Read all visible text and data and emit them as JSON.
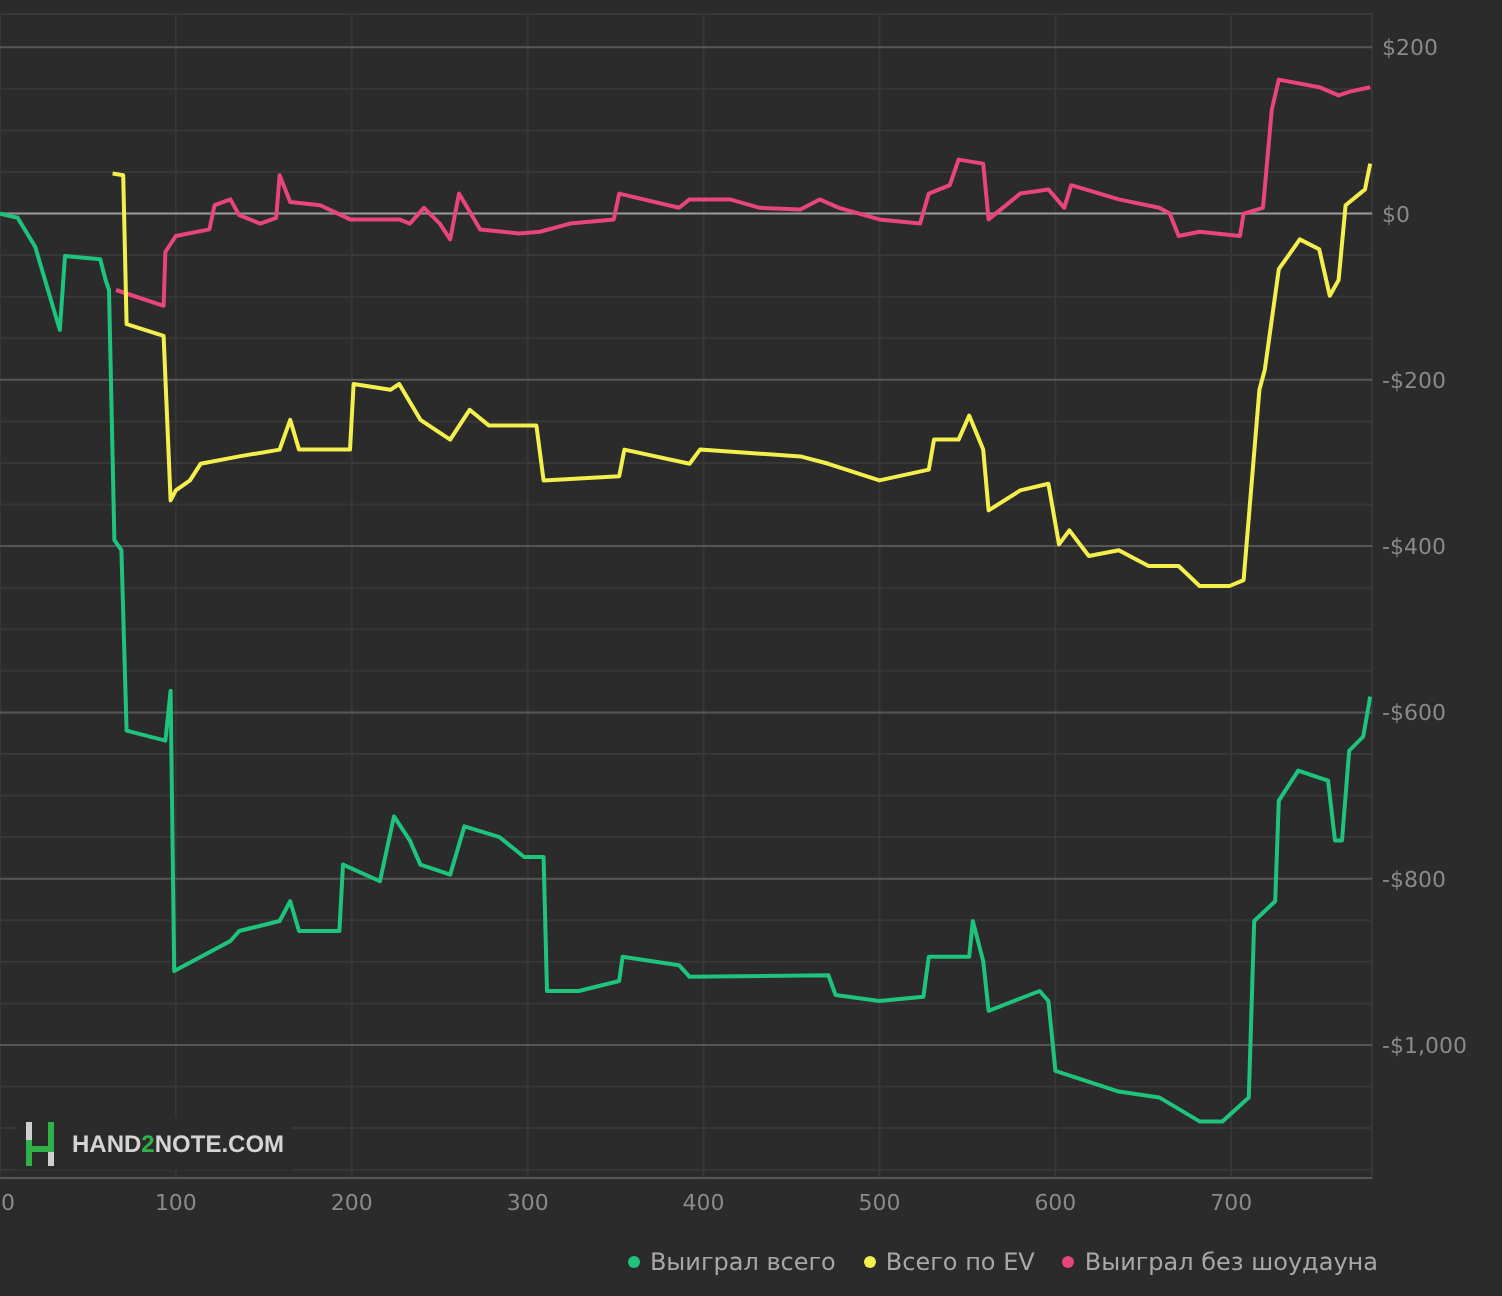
{
  "chart": {
    "chart_data": {
      "type": "line",
      "grid": true,
      "xlim": [
        0,
        780
      ],
      "ylim": [
        -1160,
        240
      ],
      "xticks": [
        0,
        100,
        200,
        300,
        400,
        500,
        600,
        700
      ],
      "yticks": [
        {
          "value": 200,
          "label": "$200"
        },
        {
          "value": 0,
          "label": "$0"
        },
        {
          "value": -200,
          "label": "-$200"
        },
        {
          "value": -400,
          "label": "-$400"
        },
        {
          "value": -600,
          "label": "-$600"
        },
        {
          "value": -800,
          "label": "-$800"
        },
        {
          "value": -1000,
          "label": "-$1,000"
        }
      ],
      "series": [
        {
          "name": "Выиграл всего",
          "color": "#1ec47c",
          "x": [
            0,
            10,
            20,
            34,
            37,
            57,
            60,
            62,
            65,
            69,
            72,
            94,
            97,
            99,
            131,
            136,
            159,
            165,
            170,
            193,
            195,
            216,
            224,
            233,
            239,
            256,
            264,
            284,
            298,
            309,
            311,
            329,
            352,
            354,
            386,
            392,
            471,
            475,
            500,
            525,
            528,
            551,
            553,
            559,
            562,
            591,
            596,
            600,
            636,
            659,
            682,
            695,
            710,
            713,
            725,
            727,
            738,
            755,
            759,
            763,
            767,
            775,
            779
          ],
          "values": [
            0,
            -5,
            -40,
            -140,
            -51,
            -55,
            -80,
            -92,
            -393,
            -405,
            -622,
            -634,
            -574,
            -911,
            -875,
            -863,
            -851,
            -827,
            -863,
            -863,
            -783,
            -803,
            -725,
            -754,
            -783,
            -795,
            -737,
            -750,
            -774,
            -774,
            -935,
            -935,
            -923,
            -894,
            -904,
            -918,
            -916,
            -940,
            -947,
            -942,
            -894,
            -894,
            -851,
            -899,
            -959,
            -935,
            -947,
            -1031,
            -1056,
            -1063,
            -1092,
            -1092,
            -1063,
            -851,
            -827,
            -706,
            -670,
            -682,
            -754,
            -754,
            -646,
            -629,
            -581
          ]
        },
        {
          "name": "Всего по EV",
          "color": "#f4ef4c",
          "x": [
            64,
            70,
            72,
            93,
            97,
            100,
            108,
            114,
            136,
            159,
            165,
            170,
            199,
            201,
            222,
            227,
            239,
            256,
            267,
            278,
            305,
            309,
            352,
            355,
            392,
            398,
            455,
            471,
            500,
            528,
            531,
            545,
            551,
            559,
            562,
            580,
            596,
            602,
            608,
            619,
            636,
            653,
            670,
            682,
            699,
            707,
            716,
            719,
            727,
            739,
            750,
            756,
            761,
            765,
            776,
            779
          ],
          "values": [
            48,
            46,
            -133,
            -147,
            -345,
            -333,
            -321,
            -301,
            -292,
            -284,
            -248,
            -284,
            -284,
            -205,
            -212,
            -205,
            -248,
            -272,
            -236,
            -255,
            -255,
            -321,
            -316,
            -284,
            -301,
            -284,
            -292,
            -301,
            -321,
            -308,
            -272,
            -272,
            -243,
            -284,
            -357,
            -333,
            -325,
            -398,
            -381,
            -412,
            -405,
            -424,
            -424,
            -448,
            -448,
            -441,
            -212,
            -188,
            -67,
            -31,
            -43,
            -99,
            -80,
            10,
            29,
            60
          ]
        },
        {
          "name": "Выиграл без шоудауна",
          "color": "#e8457a",
          "x": [
            66,
            93,
            94,
            100,
            119,
            122,
            131,
            136,
            148,
            157,
            159,
            165,
            182,
            199,
            227,
            233,
            241,
            250,
            256,
            261,
            273,
            295,
            307,
            324,
            349,
            352,
            386,
            392,
            415,
            432,
            455,
            466,
            477,
            500,
            523,
            528,
            540,
            545,
            559,
            562,
            580,
            596,
            605,
            609,
            636,
            659,
            665,
            670,
            682,
            705,
            707,
            718,
            723,
            727,
            750,
            761,
            768,
            779
          ],
          "values": [
            -92,
            -111,
            -46,
            -27,
            -19,
            10,
            17,
            -2,
            -12,
            -5,
            46,
            14,
            10,
            -7,
            -7,
            -12,
            7,
            -12,
            -31,
            24,
            -19,
            -24,
            -22,
            -12,
            -7,
            24,
            7,
            17,
            17,
            7,
            5,
            17,
            7,
            -7,
            -12,
            24,
            34,
            65,
            60,
            -7,
            24,
            29,
            7,
            34,
            17,
            7,
            0,
            -27,
            -22,
            -27,
            0,
            7,
            125,
            161,
            152,
            142,
            147,
            152
          ]
        }
      ]
    }
  },
  "watermark_logo": {
    "text": "HAND",
    "accent": "2",
    "rest": "NOTE.COM"
  }
}
